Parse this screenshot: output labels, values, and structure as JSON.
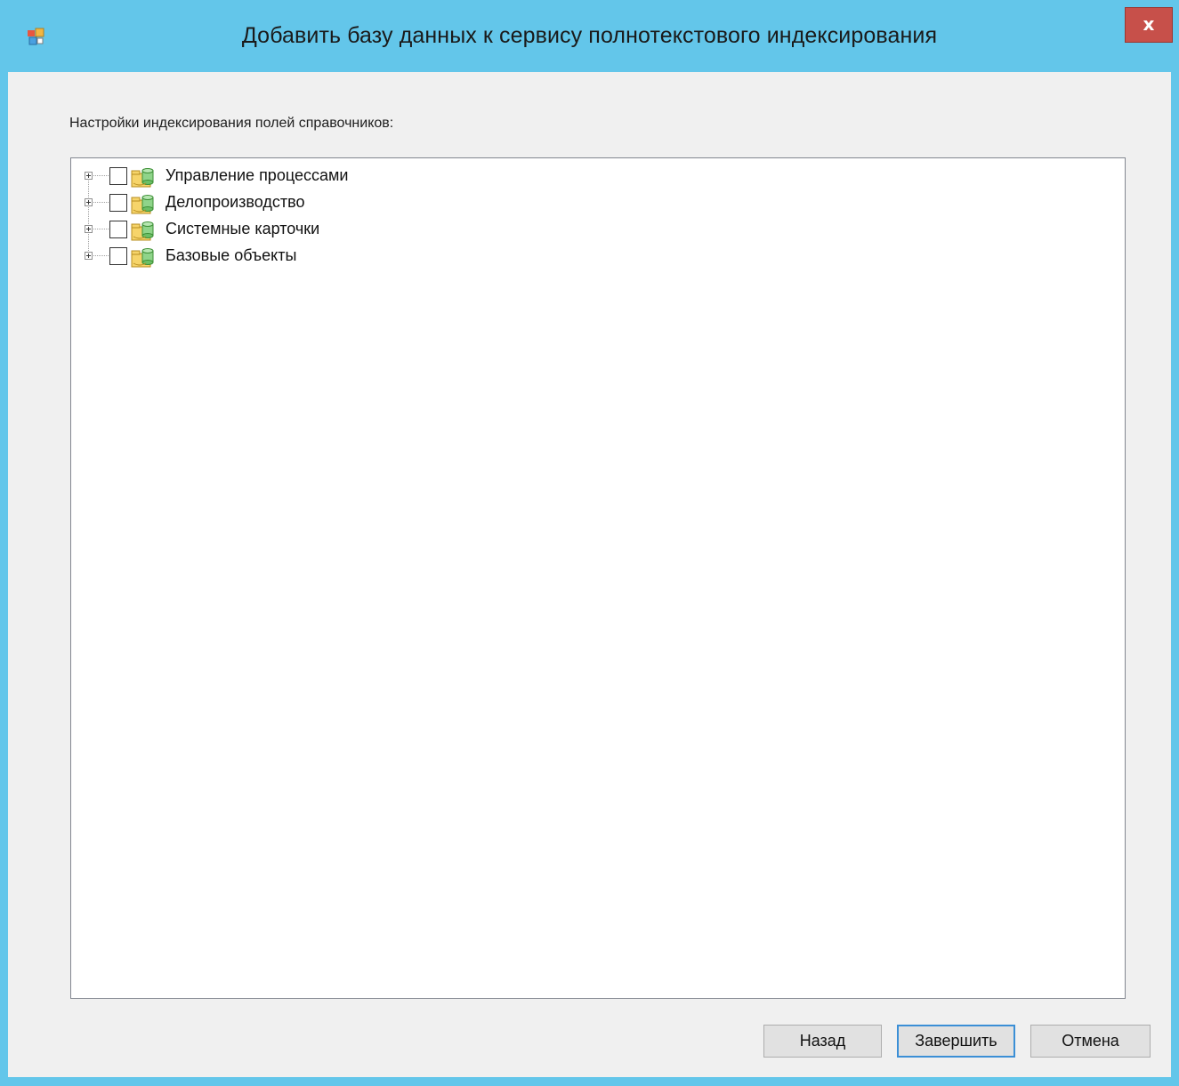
{
  "window": {
    "title": "Добавить базу данных к сервису полнотекстового индексирования",
    "close_label": "x",
    "icon": "app-window-icon"
  },
  "content": {
    "section_label": "Настройки индексирования полей справочников:"
  },
  "tree": {
    "items": [
      {
        "label": "Управление процессами",
        "checked": false,
        "expanded": false,
        "icon": "database-folder-icon"
      },
      {
        "label": "Делопроизводство",
        "checked": false,
        "expanded": false,
        "icon": "database-folder-icon"
      },
      {
        "label": "Системные карточки",
        "checked": false,
        "expanded": false,
        "icon": "database-folder-icon"
      },
      {
        "label": "Базовые объекты",
        "checked": false,
        "expanded": false,
        "icon": "database-folder-icon"
      }
    ]
  },
  "buttons": {
    "back": "Назад",
    "finish": "Завершить",
    "cancel": "Отмена"
  },
  "colors": {
    "frame": "#63c6ea",
    "close_button": "#c7504a",
    "client_background": "#f0f0f0",
    "focus_border": "#3b8fd6"
  }
}
